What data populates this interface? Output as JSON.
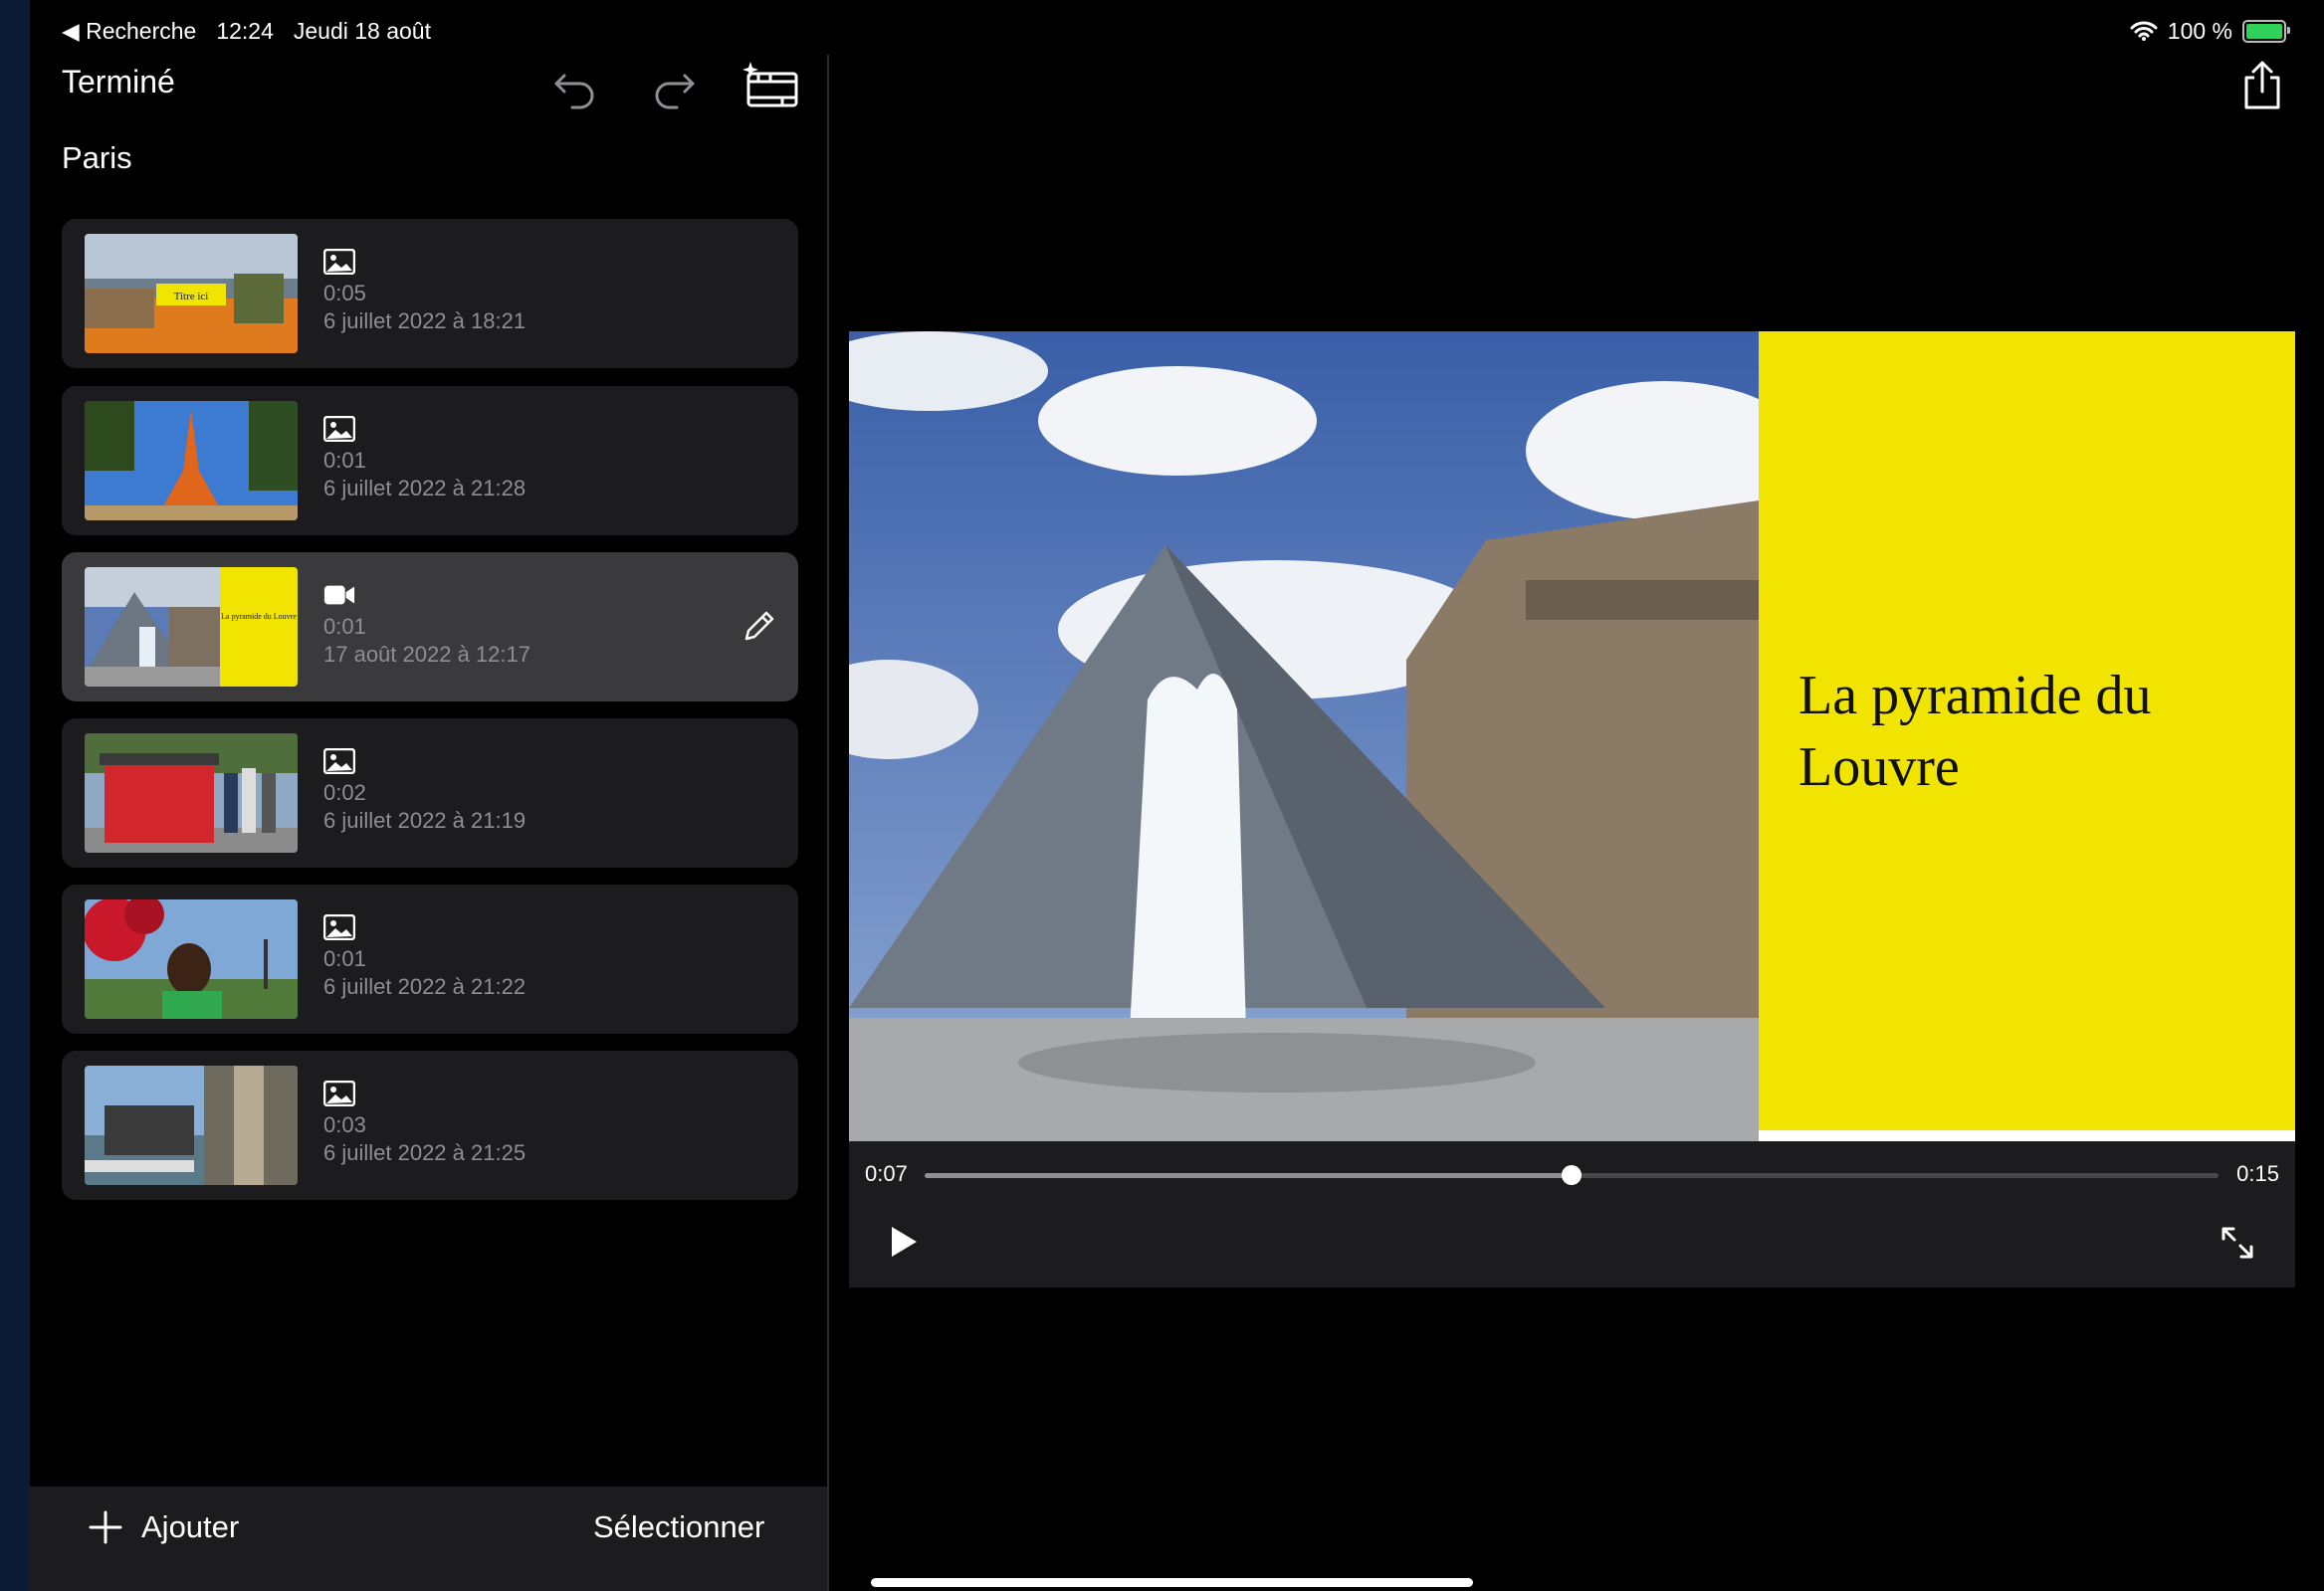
{
  "status_bar": {
    "back_app": "◀ Recherche",
    "time": "12:24",
    "date": "Jeudi 18 août",
    "battery": "100 %",
    "icons": [
      "wifi-icon",
      "battery-charging-icon"
    ]
  },
  "sidebar": {
    "done_label": "Terminé",
    "project_title": "Paris",
    "toolbar_icons": [
      "undo-icon",
      "redo-icon",
      "magic-movie-icon"
    ],
    "clips": [
      {
        "type": "photo",
        "icon": "photo-icon",
        "duration": "0:05",
        "date": "6 juillet 2022 à 18:21",
        "selected": false
      },
      {
        "type": "photo",
        "icon": "photo-icon",
        "duration": "0:01",
        "date": "6 juillet 2022 à 21:28",
        "selected": false
      },
      {
        "type": "video",
        "icon": "video-camera-icon",
        "duration": "0:01",
        "date": "17 août 2022 à 12:17",
        "selected": true
      },
      {
        "type": "photo",
        "icon": "photo-icon",
        "duration": "0:02",
        "date": "6 juillet 2022 à 21:19",
        "selected": false
      },
      {
        "type": "photo",
        "icon": "photo-icon",
        "duration": "0:01",
        "date": "6 juillet 2022 à 21:22",
        "selected": false
      },
      {
        "type": "photo",
        "icon": "photo-icon",
        "duration": "0:03",
        "date": "6 juillet 2022 à 21:25",
        "selected": false
      }
    ],
    "thumb_titles": {
      "clip1": "Titre ici",
      "clip3": "La pyramide du Louvre"
    },
    "add_label": "Ajouter",
    "select_label": "Sélectionner"
  },
  "preview": {
    "title_card": "La pyramide du Louvre",
    "current_time": "0:07",
    "total_time": "0:15",
    "progress": 0.5,
    "accent_yellow": "#f0e400"
  }
}
